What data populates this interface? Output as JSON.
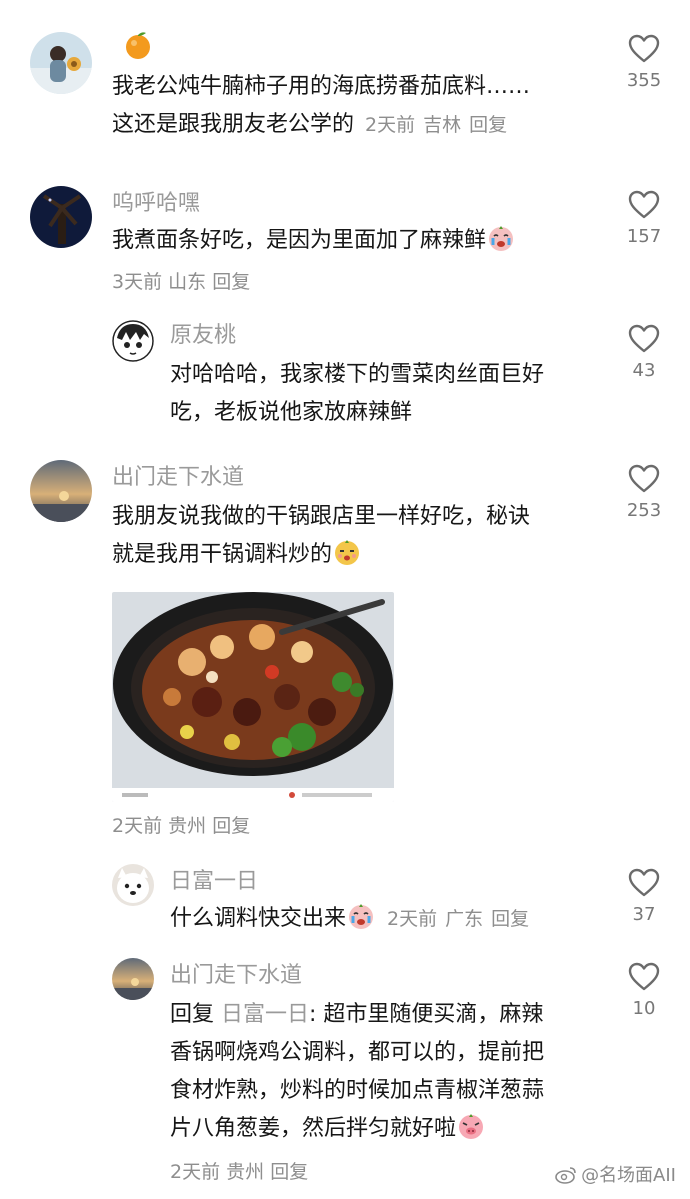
{
  "comments": [
    {
      "name_emoji": "orange-emoji",
      "text_line1": "我老公炖牛腩柿子用的海底捞番茄底料……",
      "text_line2": "这还是跟我朋友老公学的",
      "time": "2天前",
      "location": "吉林",
      "reply_label": "回复",
      "likes": "355"
    },
    {
      "name": "呜呼哈嘿",
      "text": "我煮面条好吃，是因为里面加了麻辣鲜",
      "time": "3天前",
      "location": "山东",
      "reply_label": "回复",
      "likes": "157",
      "replies": [
        {
          "name": "原友桃",
          "text_line1": "对哈哈哈，我家楼下的雪菜肉丝面巨好",
          "text_line2": "吃，老板说他家放麻辣鲜",
          "likes": "43"
        }
      ]
    },
    {
      "name": "出门走下水道",
      "text_line1": "我朋友说我做的干锅跟店里一样好吃，秘诀",
      "text_line2": "就是我用干锅调料炒的",
      "time": "2天前",
      "location": "贵州",
      "reply_label": "回复",
      "likes": "253",
      "replies": [
        {
          "name": "日富一日",
          "text": "什么调料快交出来",
          "time": "2天前",
          "location": "广东",
          "reply_label": "回复",
          "likes": "37"
        },
        {
          "name": "出门走下水道",
          "reply_prefix": "回复",
          "reply_target": "日富一日",
          "text_line1": ": 超市里随便买滴，麻辣",
          "text_line2": "香锅啊烧鸡公调料，都可以的，提前把",
          "text_line3": "食材炸熟，炒料的时候加点青椒洋葱蒜",
          "text_line4": "片八角葱姜，然后拌匀就好啦",
          "time": "2天前",
          "location": "贵州",
          "reply_label": "回复",
          "likes": "10"
        }
      ]
    }
  ],
  "watermark": "@名场面AII",
  "colors": {
    "text": "#161616",
    "muted": "#8e8e8e",
    "heart": "#6b6b6b"
  }
}
